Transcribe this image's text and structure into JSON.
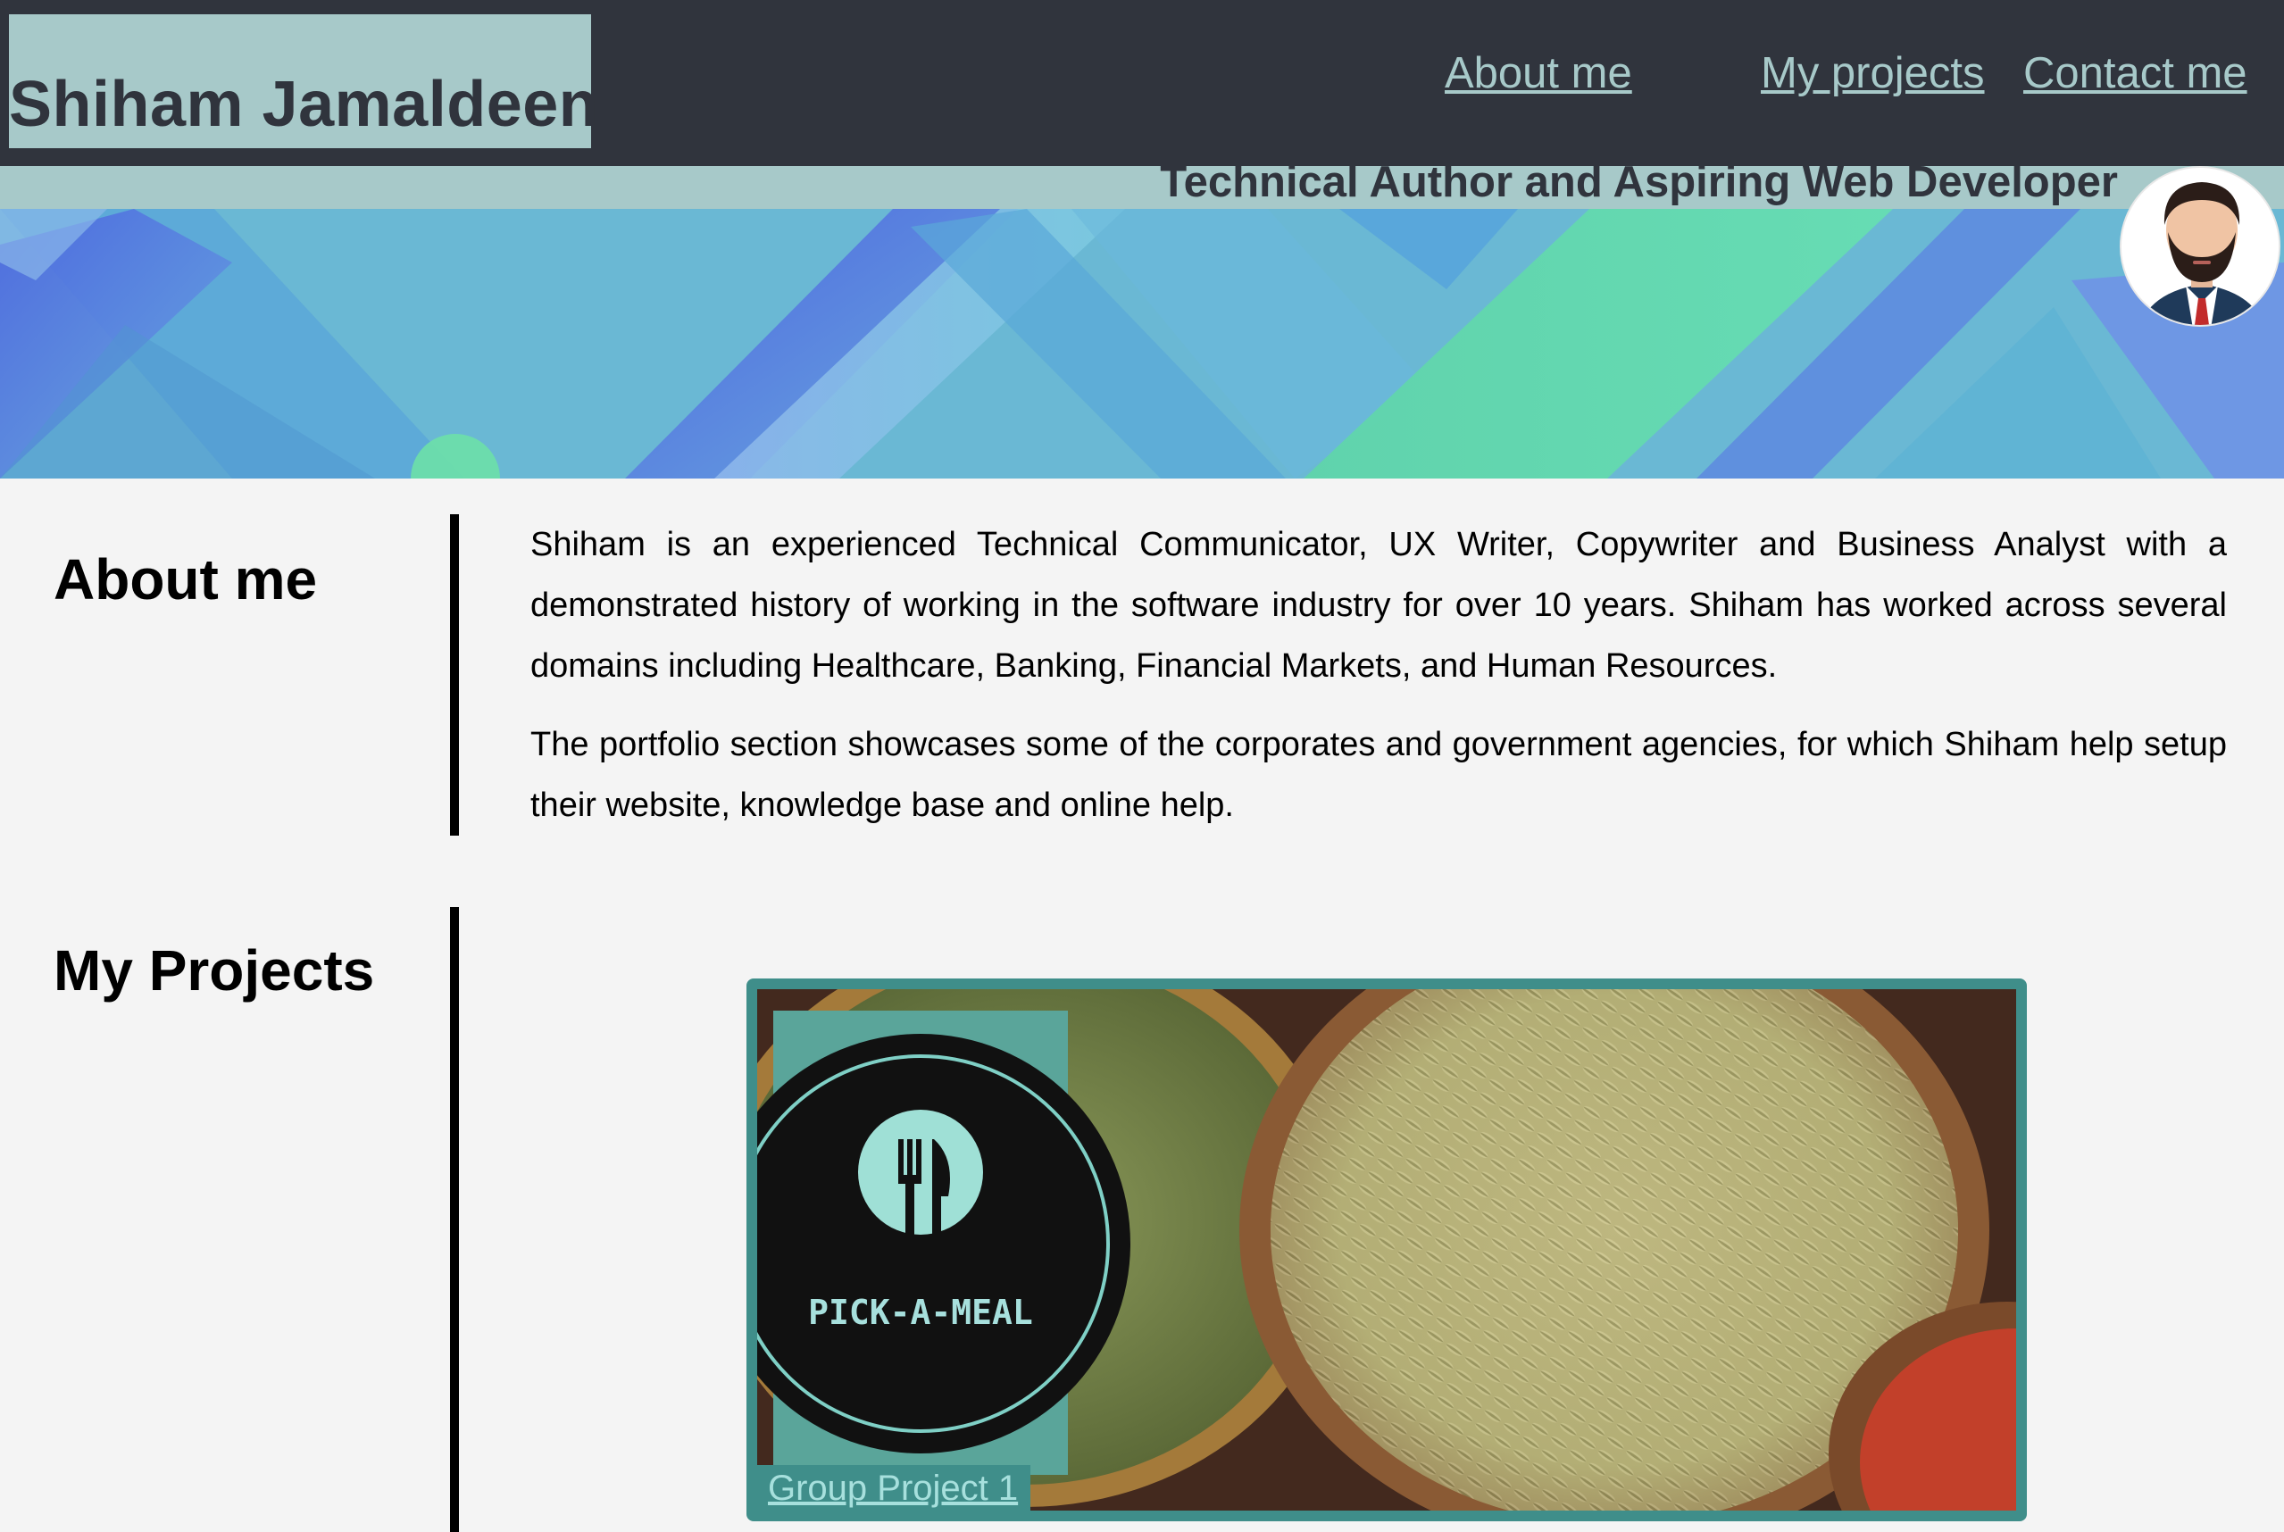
{
  "header": {
    "brand_name": "Shiham Jamaldeen",
    "nav": [
      {
        "label": "About me"
      },
      {
        "label": "My projects"
      },
      {
        "label": "Contact me"
      }
    ],
    "tagline": "Technical Author and Aspiring Web Developer"
  },
  "about": {
    "heading": "About me",
    "paragraphs": [
      "Shiham is an experienced Technical Communicator, UX Writer, Copywriter and Business Analyst with a demonstrated history of working in the software industry for over 10 years. Shiham has worked across several domains including Healthcare, Banking, Financial Markets, and Human Resources.",
      "The portfolio section showcases some of the corporates and government agencies, for which Shiham help setup their website, knowledge base and online help."
    ]
  },
  "projects": {
    "heading": "My Projects",
    "items": [
      {
        "logo_text": "PICK-A-MEAL",
        "caption": "Group Project 1"
      }
    ]
  },
  "colors": {
    "header_bg": "#30343d",
    "accent_teal": "#a7c9c9",
    "card_border": "#3f8e8a",
    "page_bg": "#f4f4f4"
  }
}
